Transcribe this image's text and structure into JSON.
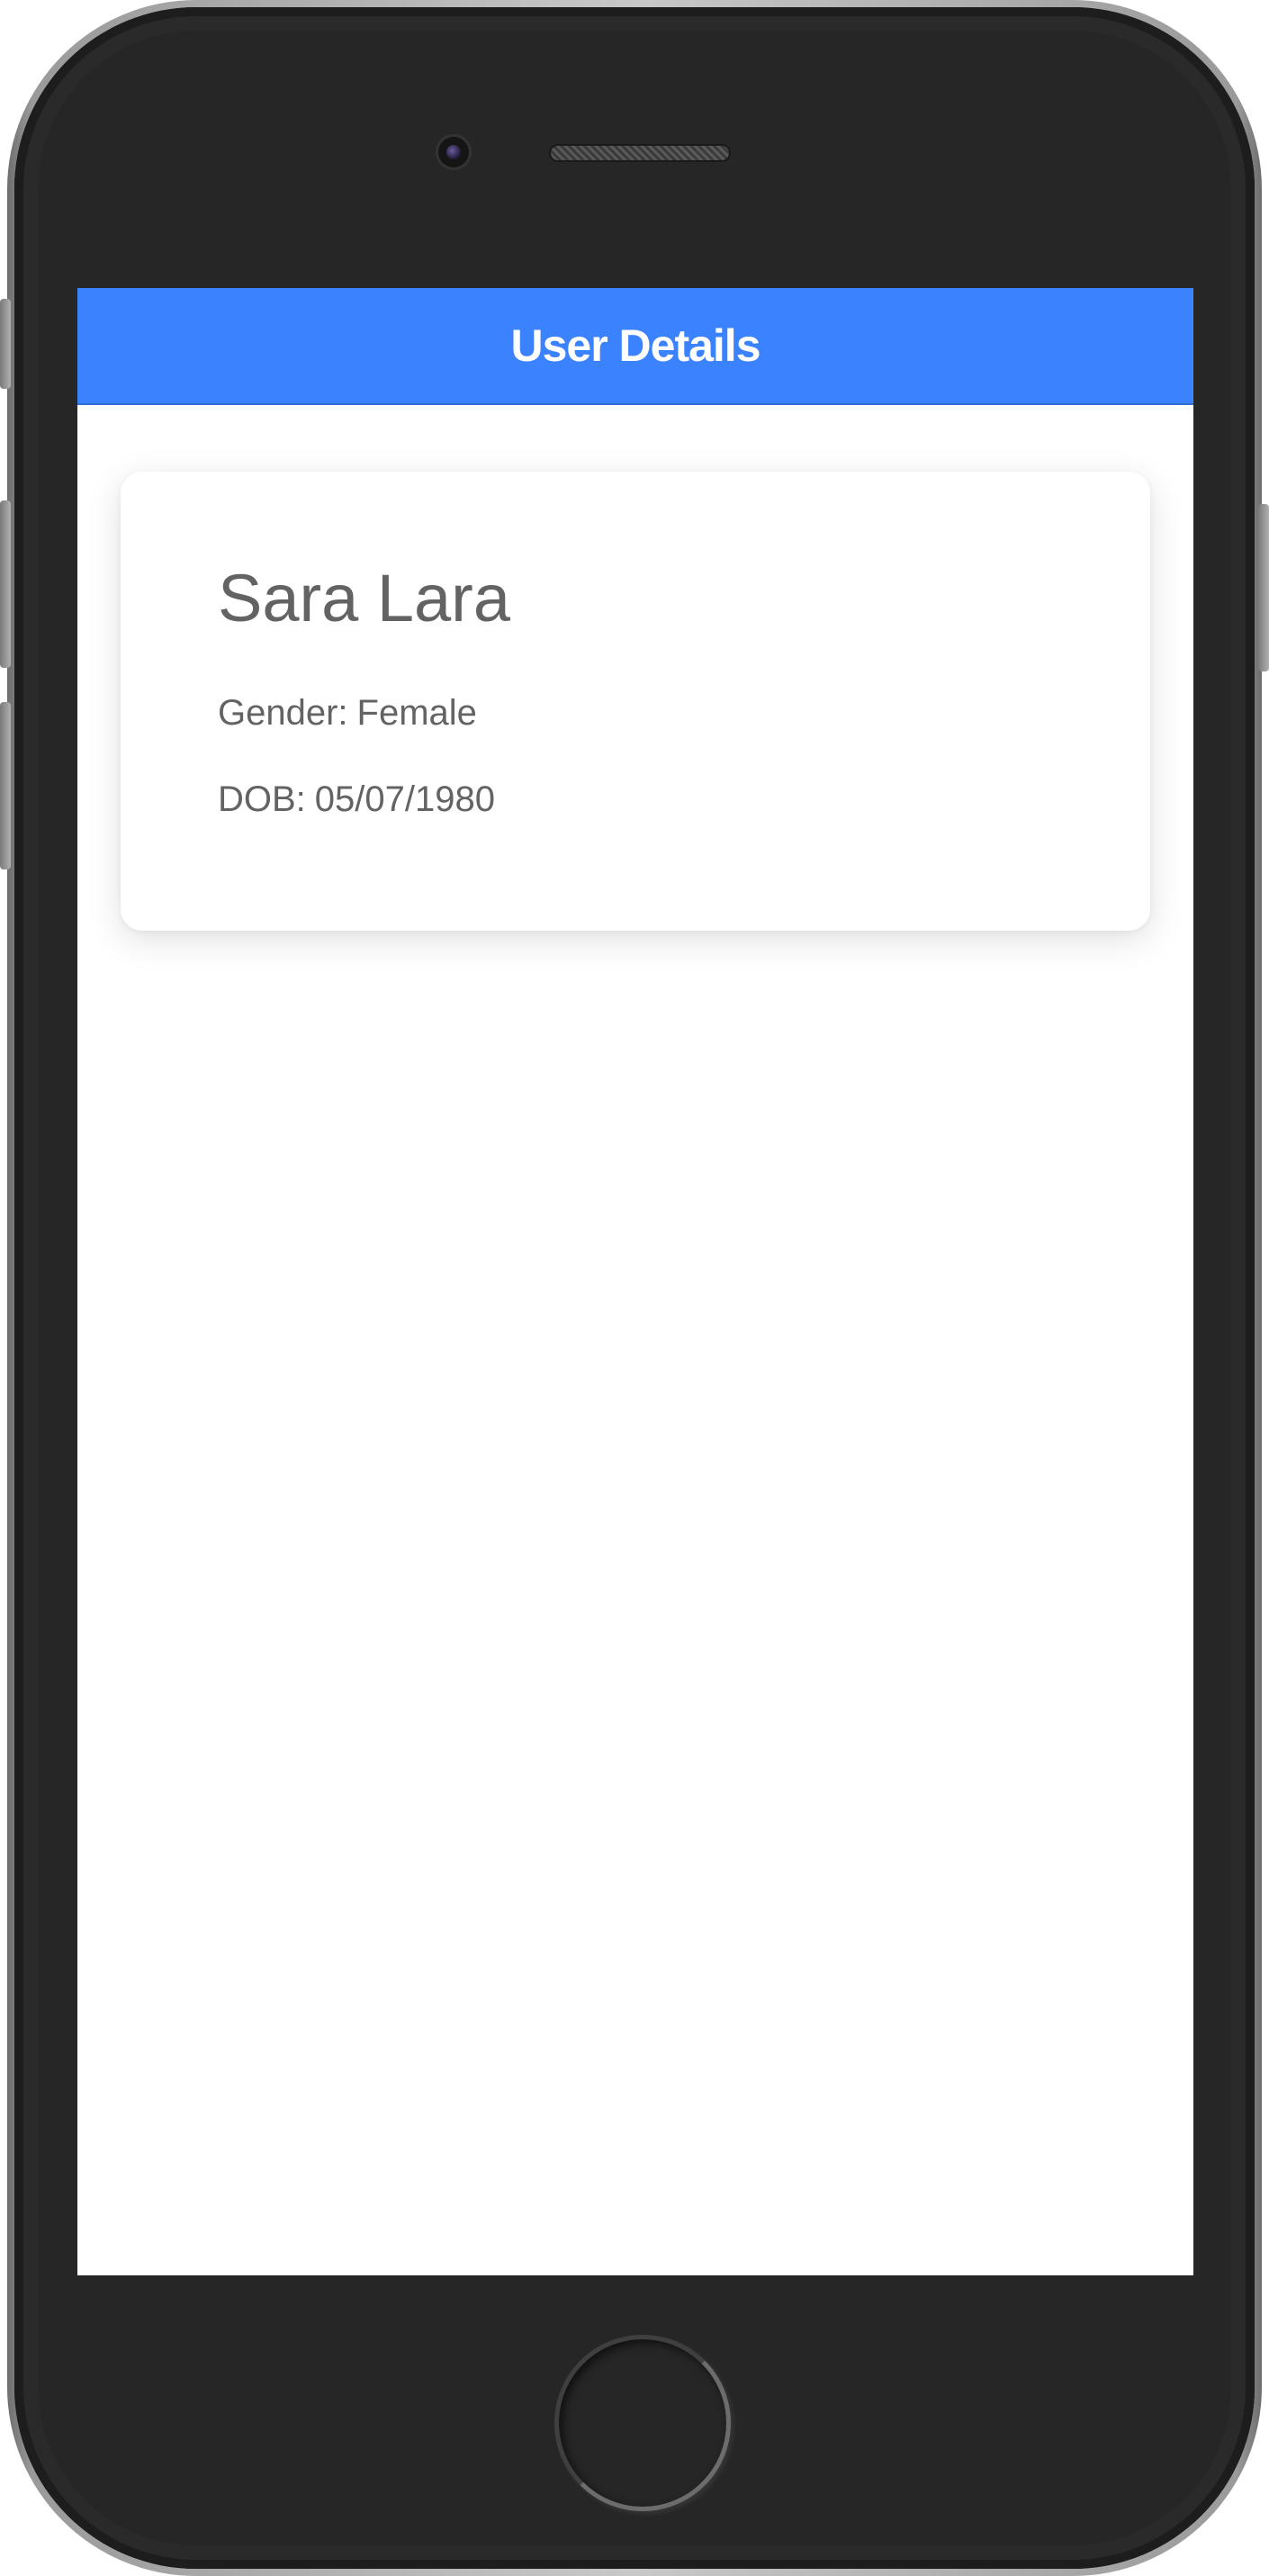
{
  "header": {
    "title": "User Details",
    "background_color": "#3b82fe"
  },
  "user": {
    "name": "Sara Lara",
    "gender_label": "Gender:",
    "gender": "Female",
    "dob_label": "DOB:",
    "dob": "05/07/1980"
  },
  "device": {
    "frame_color": "#262626",
    "icons": [
      "front-camera-icon",
      "speaker-grille-icon",
      "home-button"
    ]
  }
}
